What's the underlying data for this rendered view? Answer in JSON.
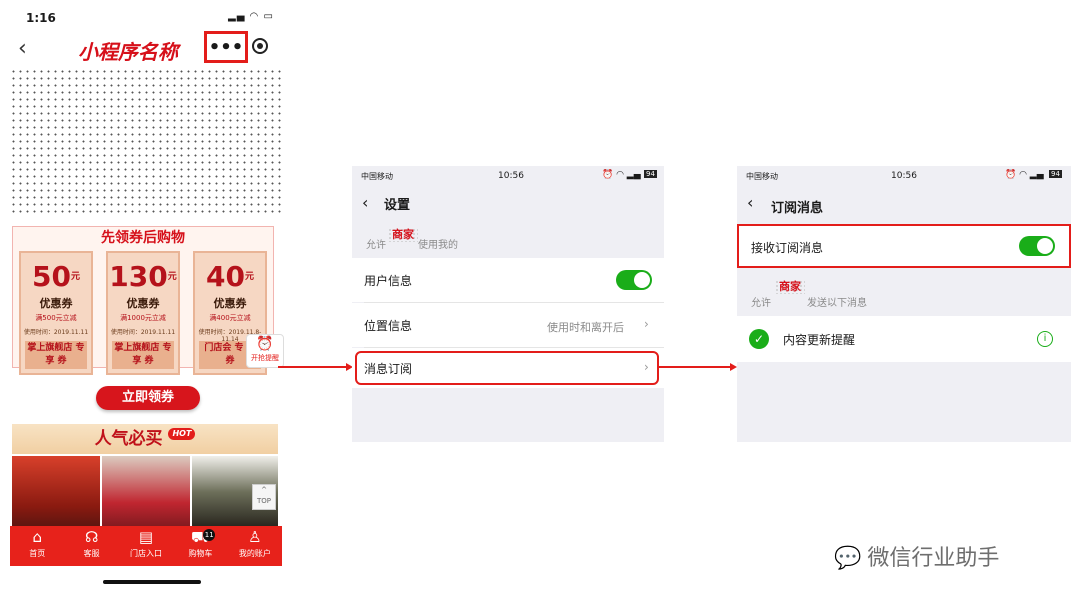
{
  "phone1": {
    "status_time": "1:16",
    "app_title": "小程序名称",
    "more_label": "•••",
    "coupon_heading": "先领券后购物",
    "coupons": [
      {
        "amount": "50",
        "name": "优惠券",
        "condition": "满500元立减",
        "date": "使用时间：2019.11.11",
        "footer": "掌上旗舰店 专 享 券"
      },
      {
        "amount": "130",
        "name": "优惠券",
        "condition": "满1000元立减",
        "date": "使用时间：2019.11.11",
        "footer": "掌上旗舰店 专 享 券"
      },
      {
        "amount": "40",
        "name": "优惠券",
        "condition": "满400元立减",
        "date": "使用时间：2019.11.8-11.14",
        "footer": "门店会 专 享 券"
      }
    ],
    "remind_label": "开抢提醒",
    "claim_button": "立即领券",
    "hot_banner": "人气必买",
    "hot_tag": "HOT",
    "top_label": "TOP",
    "tabs": [
      {
        "icon": "⌂",
        "label": "首页"
      },
      {
        "icon": "☊",
        "label": "客服"
      },
      {
        "icon": "▤",
        "label": "门店入口"
      },
      {
        "icon": "⛟",
        "label": "购物车"
      },
      {
        "icon": "♙",
        "label": "我的账户"
      }
    ],
    "cart_badge": "11"
  },
  "phone2": {
    "carrier": "中国移动",
    "time": "10:56",
    "battery": "94",
    "nav_title": "设置",
    "hint_prefix": "允许",
    "merchant": "商家",
    "hint_suffix": "使用我的",
    "rows": {
      "user_info": "用户信息",
      "location": "位置信息",
      "location_value": "使用时和离开后",
      "subscription": "消息订阅"
    }
  },
  "phone3": {
    "carrier": "中国移动",
    "time": "10:56",
    "battery": "94",
    "nav_title": "订阅消息",
    "receive_label": "接收订阅消息",
    "hint_prefix": "允许",
    "merchant": "商家",
    "hint_suffix": "发送以下消息",
    "item_label": "内容更新提醒"
  },
  "watermark": "微信行业助手",
  "colors": {
    "accent_red": "#e31d1a",
    "toggle_green": "#1aad19"
  }
}
